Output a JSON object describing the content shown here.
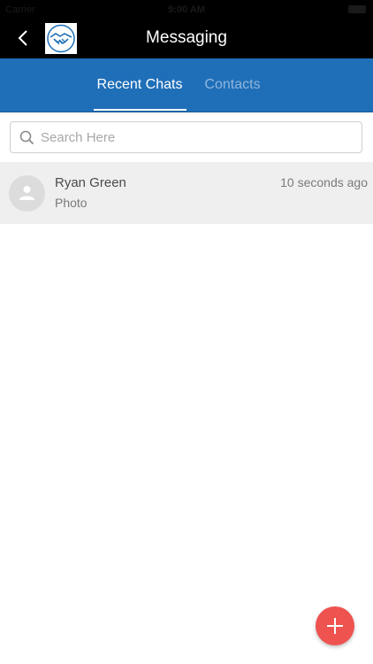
{
  "status_bar": {
    "carrier": "Carrier",
    "time": "9:00 AM"
  },
  "nav": {
    "title": "Messaging",
    "back_icon": "chevron-left-icon",
    "logo_icon": "handshake-logo-icon"
  },
  "tabs": [
    {
      "label": "Recent Chats",
      "active": true
    },
    {
      "label": "Contacts",
      "active": false
    }
  ],
  "search": {
    "placeholder": "Search Here",
    "value": ""
  },
  "chats": [
    {
      "name": "Ryan Green",
      "preview": "Photo",
      "time": "10 seconds ago"
    }
  ],
  "fab": {
    "icon": "plus-icon"
  },
  "colors": {
    "nav_bg": "#000000",
    "tab_bg": "#1f6fb8",
    "tab_active": "#ffffff",
    "tab_inactive": "#8fb6de",
    "row_bg": "#efefef",
    "fab_bg": "#ef5350"
  }
}
